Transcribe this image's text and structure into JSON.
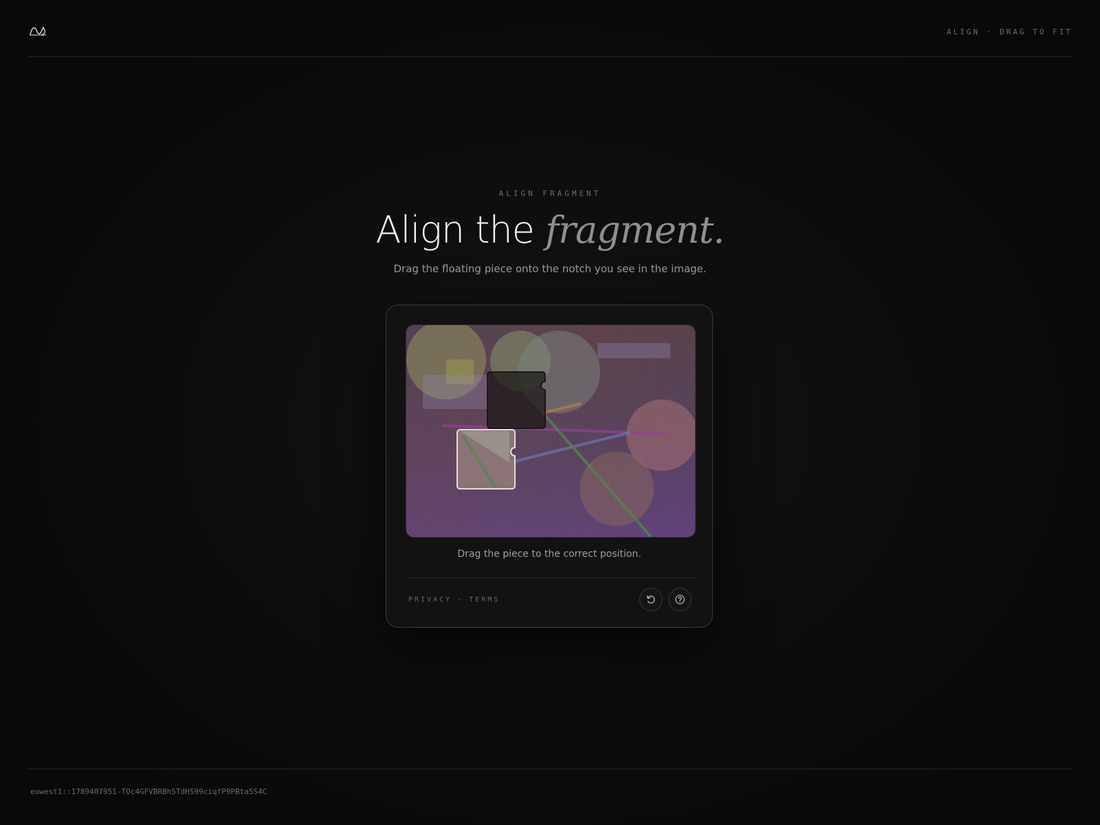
{
  "header": {
    "logo_icon": "wave-logo-icon",
    "right_label": "ALIGN · DRAG TO FIT"
  },
  "hero": {
    "eyebrow": "ALIGN FRAGMENT",
    "title_main": "Align the ",
    "title_accent": "fragment.",
    "subtitle": "Drag the floating piece onto the notch you see in the image."
  },
  "card": {
    "instruction": "Drag the piece to the correct position.",
    "links": {
      "privacy": "PRIVACY",
      "separator": "·",
      "terms": "TERMS"
    },
    "buttons": {
      "refresh_icon": "refresh-icon",
      "help_icon": "help-icon"
    }
  },
  "footer": {
    "session_id": "euwest1::1789407951-TOc4GFVBRBh5TdHS99ciqfP9PBta5S4C"
  },
  "colors": {
    "background": "#0b0b0b",
    "card_background": "#121212",
    "text_primary": "#f2f2f2",
    "text_muted": "#9a9a9a",
    "accent_italic": "#8f8f8f"
  }
}
